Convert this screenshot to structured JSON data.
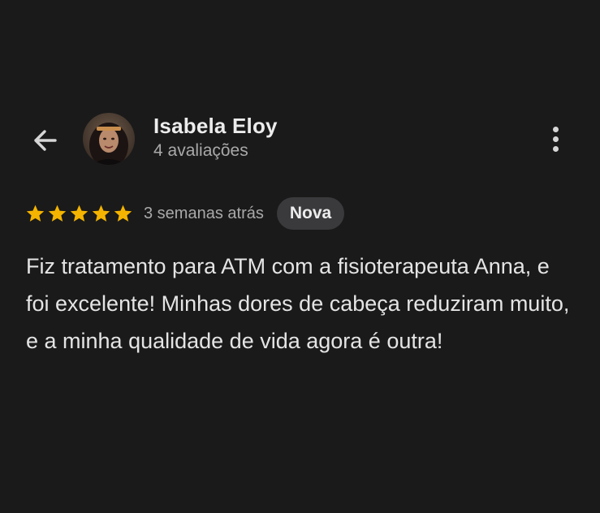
{
  "header": {
    "back_icon": "arrow-left-icon",
    "avatar_icon": "profile-photo",
    "reviewer_name": "Isabela Eloy",
    "review_count": "4 avaliações",
    "more_icon": "more-vert-icon"
  },
  "review": {
    "rating": 5,
    "max_rating": 5,
    "star_color": "#f5b400",
    "time_ago": "3 semanas atrás",
    "badge": "Nova",
    "text": "Fiz tratamento para ATM com a fisioterapeuta Anna, e foi excelente! Minhas dores de cabeça reduziram muito, e a minha qualidade de vida agora é outra!"
  }
}
